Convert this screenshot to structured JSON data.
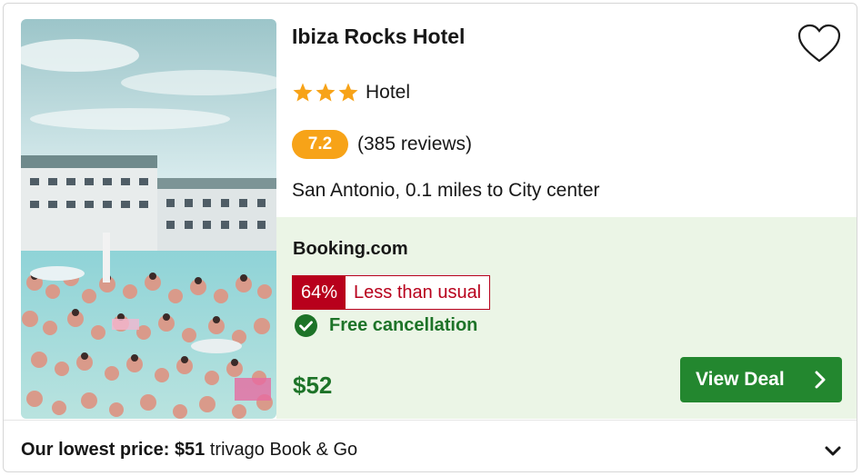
{
  "hotel": {
    "name": "Ibiza Rocks Hotel",
    "star_count": 3,
    "type": "Hotel",
    "rating": "7.2",
    "reviews": "(385 reviews)",
    "location": "San Antonio, 0.1 miles to City center"
  },
  "deal": {
    "provider": "Booking.com",
    "discount": "64%",
    "discount_text": "Less than usual",
    "cancellation": "Free cancellation",
    "price": "$52",
    "button_label": "View Deal"
  },
  "footer": {
    "lowest_label": "Our lowest price:",
    "lowest_price": "$51",
    "lowest_source": "trivago Book & Go"
  },
  "icons": {
    "heart": "heart-icon",
    "star": "star-icon",
    "check": "check-circle-icon",
    "chevron_right": "chevron-right-icon",
    "chevron_down": "chevron-down-icon"
  },
  "colors": {
    "star": "#f7a318",
    "rating_badge": "#f7a318",
    "deal_background": "#ebf5e6",
    "discount_red": "#b8001c",
    "green": "#1d7328",
    "button_green": "#23872f"
  }
}
